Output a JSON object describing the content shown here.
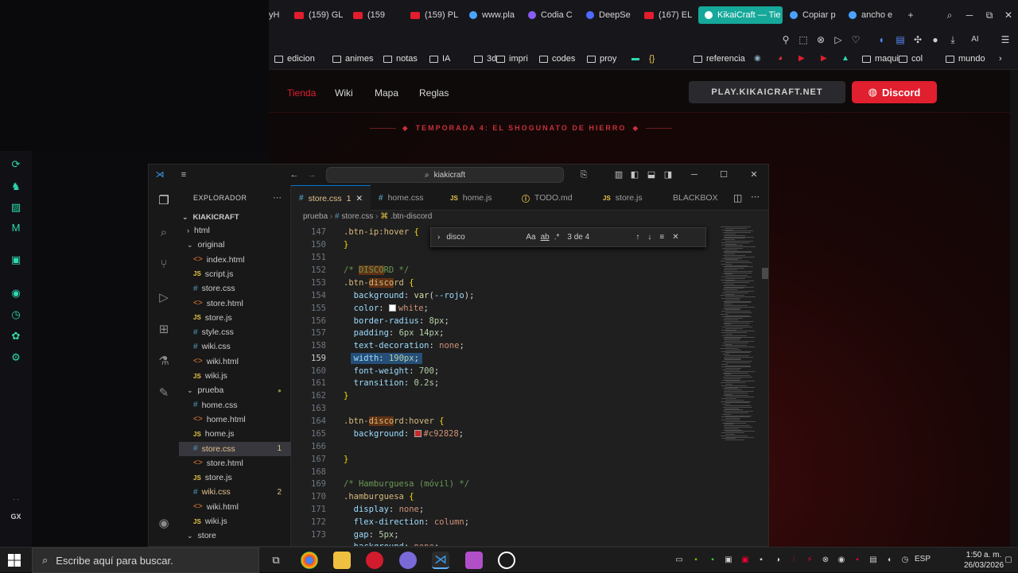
{
  "browser": {
    "tabs": [
      {
        "label": "yH",
        "icon": "youtube-icon"
      },
      {
        "label": "(159) GL",
        "icon": "youtube-icon"
      },
      {
        "label": "(159",
        "icon": "youtube-icon"
      },
      {
        "label": "(159) PL",
        "icon": "youtube-icon"
      },
      {
        "label": "www.pla",
        "icon": "globe-icon"
      },
      {
        "label": "Codia C",
        "icon": "codia-icon"
      },
      {
        "label": "DeepSe",
        "icon": "deepseek-icon"
      },
      {
        "label": "(167) EL",
        "icon": "youtube-icon"
      },
      {
        "label": "KikaiCraft — Tie",
        "icon": "page-icon"
      },
      {
        "label": "Copiar p",
        "icon": "chatgpt-icon"
      },
      {
        "label": "ancho e",
        "icon": "google-icon"
      }
    ],
    "toolbar_right_label": "AI",
    "bookmarks": [
      "edicion",
      "animes",
      "notas",
      "IA",
      "3d",
      "impri",
      "codes",
      "proy",
      "{}",
      "referencia",
      "maqui",
      "col",
      "mundo"
    ]
  },
  "site": {
    "nav": [
      "Tienda",
      "Wiki",
      "Mapa",
      "Reglas"
    ],
    "play_label": "PLAY.KIKAICRAFT.NET",
    "discord_label": "Discord",
    "season_label": "TEMPORADA 4: EL SHOGUNATO DE HIERRO",
    "accent": "#e01f2f"
  },
  "vscode": {
    "search_placeholder": "kiakicraft",
    "explorer_title": "EXPLORADOR",
    "root": "KIAKICRAFT",
    "tree": [
      {
        "label": "html",
        "kind": "folder",
        "depth": 1
      },
      {
        "label": "original",
        "kind": "folder-open",
        "depth": 1
      },
      {
        "label": "index.html",
        "kind": "html",
        "depth": 2
      },
      {
        "label": "script.js",
        "kind": "js",
        "depth": 2
      },
      {
        "label": "store.css",
        "kind": "css",
        "depth": 2
      },
      {
        "label": "store.html",
        "kind": "html",
        "depth": 2
      },
      {
        "label": "store.js",
        "kind": "js",
        "depth": 2
      },
      {
        "label": "style.css",
        "kind": "css",
        "depth": 2
      },
      {
        "label": "wiki.css",
        "kind": "css",
        "depth": 2
      },
      {
        "label": "wiki.html",
        "kind": "html",
        "depth": 2
      },
      {
        "label": "wiki.js",
        "kind": "js",
        "depth": 2
      },
      {
        "label": "prueba",
        "kind": "folder-open",
        "depth": 1
      },
      {
        "label": "home.css",
        "kind": "css",
        "depth": 2
      },
      {
        "label": "home.html",
        "kind": "html",
        "depth": 2
      },
      {
        "label": "home.js",
        "kind": "js",
        "depth": 2
      },
      {
        "label": "store.css",
        "kind": "css",
        "depth": 2,
        "selected": true,
        "badge": "1"
      },
      {
        "label": "store.html",
        "kind": "html",
        "depth": 2
      },
      {
        "label": "store.js",
        "kind": "js",
        "depth": 2
      },
      {
        "label": "wiki.css",
        "kind": "css",
        "depth": 2,
        "badge": "2"
      },
      {
        "label": "wiki.html",
        "kind": "html",
        "depth": 2
      },
      {
        "label": "wiki.js",
        "kind": "js",
        "depth": 2
      },
      {
        "label": "store",
        "kind": "folder-open",
        "depth": 1
      }
    ],
    "tabs": [
      {
        "label": "store.css",
        "suffix": "1",
        "active": true
      },
      {
        "label": "home.css"
      },
      {
        "label": "home.js"
      },
      {
        "label": "TODO.md"
      },
      {
        "label": "store.js"
      },
      {
        "label": "BLACKBOX"
      }
    ],
    "breadcrumb": [
      "prueba",
      "store.css",
      ".btn-discord"
    ],
    "find": {
      "query": "disco",
      "count": "3 de 4"
    },
    "line_numbers": [
      "147",
      "150",
      "151",
      "152",
      "153",
      "154",
      "155",
      "156",
      "157",
      "158",
      "159",
      "160",
      "161",
      "162",
      "163",
      "164",
      "165",
      "166",
      "167",
      "168",
      "169",
      "170",
      "171",
      "172",
      "173"
    ],
    "current_line": "159"
  },
  "taskbar": {
    "search_placeholder": "Escribe aquí para buscar.",
    "lang": "ESP",
    "time": "1:50 a. m.",
    "date": "26/03/2026",
    "gx_label": "GX"
  }
}
